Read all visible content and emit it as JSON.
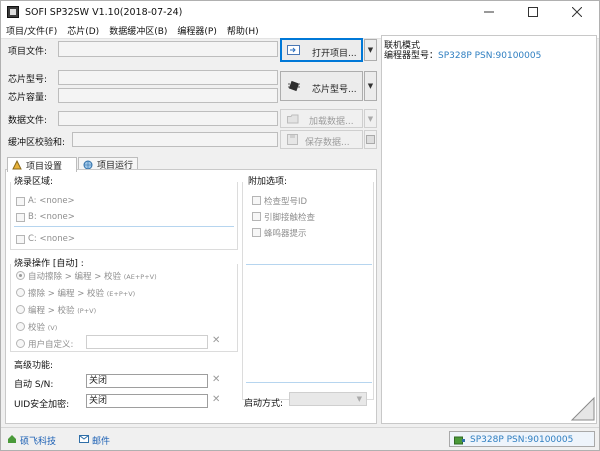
{
  "window": {
    "title": "SOFI SP32SW V1.10(2018-07-24)"
  },
  "menu": [
    "项目/文件(F)",
    "芯片(D)",
    "数据缓冲区(B)",
    "编程器(P)",
    "帮助(H)"
  ],
  "form": {
    "project_file_label": "项目文件:",
    "chip_model_label": "芯片型号:",
    "chip_capacity_label": "芯片容量:",
    "data_file_label": "数据文件:",
    "buffer_checksum_label": "缓冲区校验和:",
    "open_project_button": "打开项目...",
    "chip_model_button": "芯片型号...",
    "load_data_button": "加载数据...",
    "save_data_button": "保存数据..."
  },
  "tabs": [
    {
      "label": "项目设置",
      "active": true
    },
    {
      "label": "项目运行",
      "active": false
    }
  ],
  "burn_area": {
    "title": "烧录区域:",
    "items": [
      "A: <none>",
      "B: <none>",
      "C: <none>"
    ]
  },
  "burn_ops": {
    "title": "烧录操作 [自动] :",
    "options": [
      {
        "label": "自动擦除 > 编程 > 校验",
        "tag": "(AE+P+V)",
        "selected": true
      },
      {
        "label": "擦除 > 编程 > 校验",
        "tag": "(E+P+V)",
        "selected": false
      },
      {
        "label": "编程 > 校验",
        "tag": "(P+V)",
        "selected": false
      },
      {
        "label": "校验",
        "tag": "(V)",
        "selected": false
      },
      {
        "label": "用户自定义:",
        "tag": "",
        "selected": false
      }
    ]
  },
  "extra_options": {
    "title": "附加选项:",
    "items": [
      "检查型号ID",
      "引脚接触检查",
      "蜂鸣器提示"
    ]
  },
  "advanced": {
    "title": "高级功能:",
    "auto_sn_label": "自动 S/N:",
    "auto_sn_value": "关闭",
    "uid_label": "UID安全加密:",
    "uid_value": "关闭",
    "start_mode_label": "启动方式:"
  },
  "log": {
    "line1": "联机模式",
    "line2_prefix": "编程器型号：",
    "line2_value": "SP328P  PSN:90100005"
  },
  "status": {
    "company": "硕飞科技",
    "email": "邮件",
    "device": "SP328P  PSN:90100005"
  },
  "colors": {
    "link": "#1a5fb4",
    "accent": "#0078d7",
    "device_value": "#2f7fc1"
  }
}
